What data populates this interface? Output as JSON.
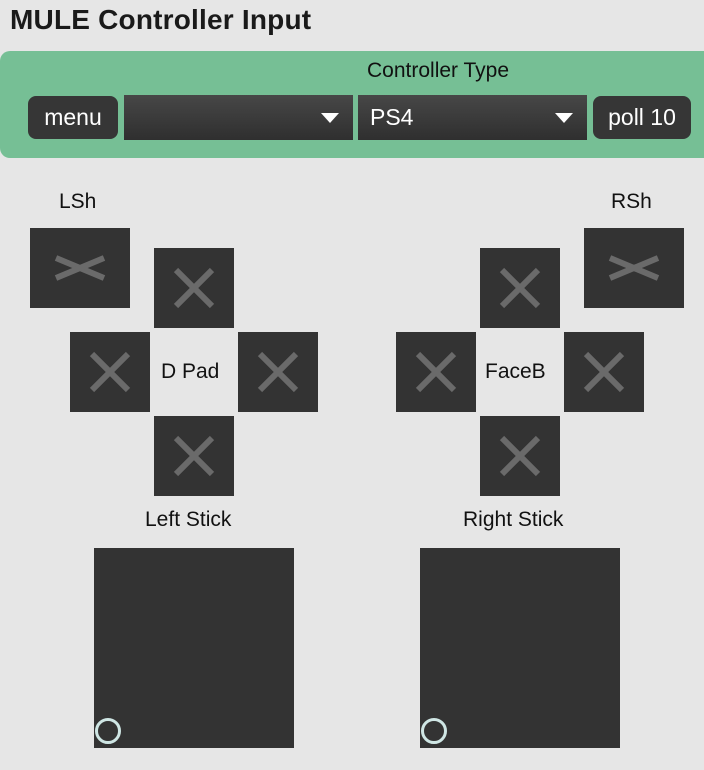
{
  "app": {
    "title": "MULE Controller Input"
  },
  "controller_panel": {
    "label": "Controller Type",
    "menu_button": "menu",
    "device_dropdown": {
      "value": ""
    },
    "type_dropdown": {
      "value": "PS4"
    },
    "poll_button": "poll 10"
  },
  "shoulders": {
    "left_label": "LSh",
    "right_label": "RSh"
  },
  "dpad": {
    "label": "D Pad"
  },
  "face_buttons": {
    "label": "FaceB"
  },
  "sticks": {
    "left_label": "Left Stick",
    "right_label": "Right Stick"
  },
  "colors": {
    "background": "#e6e6e6",
    "panel": "#76bf95",
    "button": "#333333",
    "x_mark": "#6a6a6a",
    "stick_knob": "#cfe6e4"
  },
  "icons": {
    "toggle": "x-icon",
    "dropdown": "caret-down-icon",
    "stick": "ring-icon"
  }
}
